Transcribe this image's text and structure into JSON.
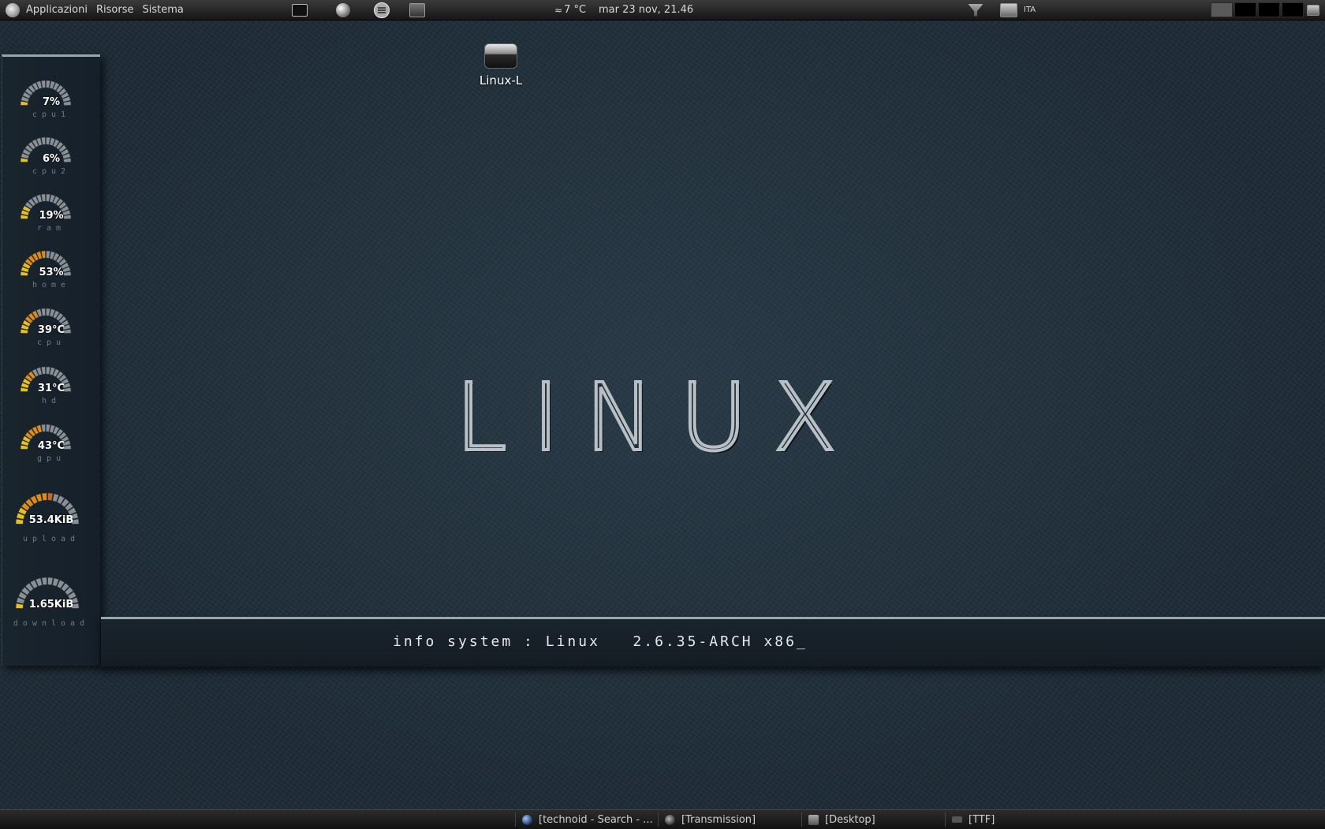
{
  "top_panel": {
    "menus": [
      "Applicazioni",
      "Risorse",
      "Sistema"
    ],
    "launchers": [
      "terminal-icon",
      "browser-icon",
      "files-icon",
      "monitor-icon"
    ],
    "weather": "7 °C",
    "datetime": "mar 23 nov, 21.46",
    "keyboard_layout": "ITA",
    "workspaces": 4,
    "active_workspace": 1
  },
  "gauges": [
    {
      "value": "7%",
      "label": "cpu1",
      "level": 7
    },
    {
      "value": "6%",
      "label": "cpu2",
      "level": 6
    },
    {
      "value": "19%",
      "label": "ram",
      "level": 19
    },
    {
      "value": "53%",
      "label": "home",
      "level": 53
    },
    {
      "value": "39°C",
      "label": "cpu",
      "level": 39
    },
    {
      "value": "31°C",
      "label": "hd",
      "level": 31
    },
    {
      "value": "43°C",
      "label": "gpu",
      "level": 43
    },
    {
      "value": "53.4KiB",
      "label": "upload",
      "level": 55
    },
    {
      "value": "1.65KiB",
      "label": "download",
      "level": 5
    }
  ],
  "desktop": {
    "icon_label": "Linux-L",
    "logo_text": "LINUX",
    "info_text": "info system : Linux   2.6.35-ARCH x86_"
  },
  "taskbar": [
    {
      "title": "[technoid - Search - ...",
      "icon": "web-icon"
    },
    {
      "title": "[Transmission]",
      "icon": "transmission-icon"
    },
    {
      "title": "[Desktop]",
      "icon": "desktop-icon"
    },
    {
      "title": "[TTF]",
      "icon": "window-icon"
    }
  ],
  "colors": {
    "accent": "#e0a020",
    "gauge_track": "#8a9196",
    "panel": "#1a1a1a"
  }
}
